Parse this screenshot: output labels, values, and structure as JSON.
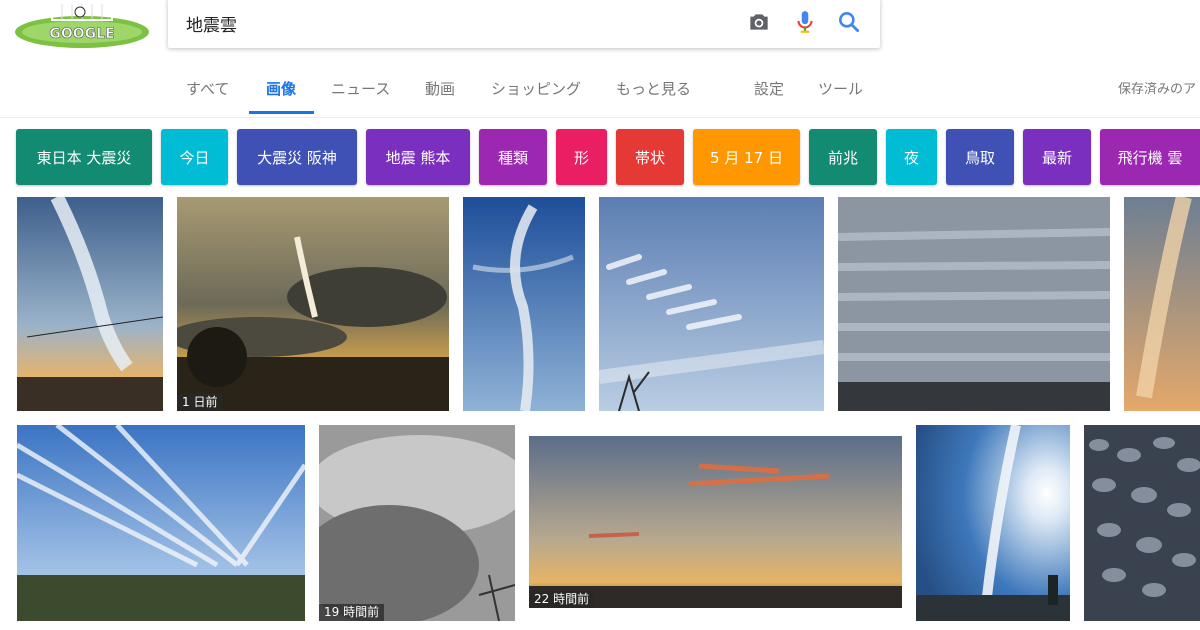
{
  "logo": {
    "text": "GOOGLE"
  },
  "search": {
    "query": "地震雲"
  },
  "icons": {
    "camera": "camera-icon",
    "mic": "microphone-icon",
    "search": "search-icon"
  },
  "tabs": [
    {
      "label": "すべて"
    },
    {
      "label": "画像"
    },
    {
      "label": "ニュース"
    },
    {
      "label": "動画"
    },
    {
      "label": "ショッピング"
    },
    {
      "label": "もっと見る"
    },
    {
      "label": "設定"
    },
    {
      "label": "ツール"
    }
  ],
  "saved": "保存済みのア",
  "chips": [
    {
      "label": "東日本 大震災",
      "color": "#138a72"
    },
    {
      "label": "今日",
      "color": "#00bcd4"
    },
    {
      "label": "大震災 阪神",
      "color": "#3f51b5"
    },
    {
      "label": "地震 熊本",
      "color": "#7b2fbf"
    },
    {
      "label": "種類",
      "color": "#9c27b0"
    },
    {
      "label": "形",
      "color": "#e91e63"
    },
    {
      "label": "帯状",
      "color": "#e53935"
    },
    {
      "label": "5 月 17 日",
      "color": "#ff9800"
    },
    {
      "label": "前兆",
      "color": "#138a72"
    },
    {
      "label": "夜",
      "color": "#00bcd4"
    },
    {
      "label": "鳥取",
      "color": "#3f51b5"
    },
    {
      "label": "最新",
      "color": "#7b2fbf"
    },
    {
      "label": "飛行機 雲",
      "color": "#9c27b0"
    }
  ],
  "timestamps": {
    "img2": "1 日前",
    "img8": "19 時間前",
    "img9": "22 時間前"
  }
}
